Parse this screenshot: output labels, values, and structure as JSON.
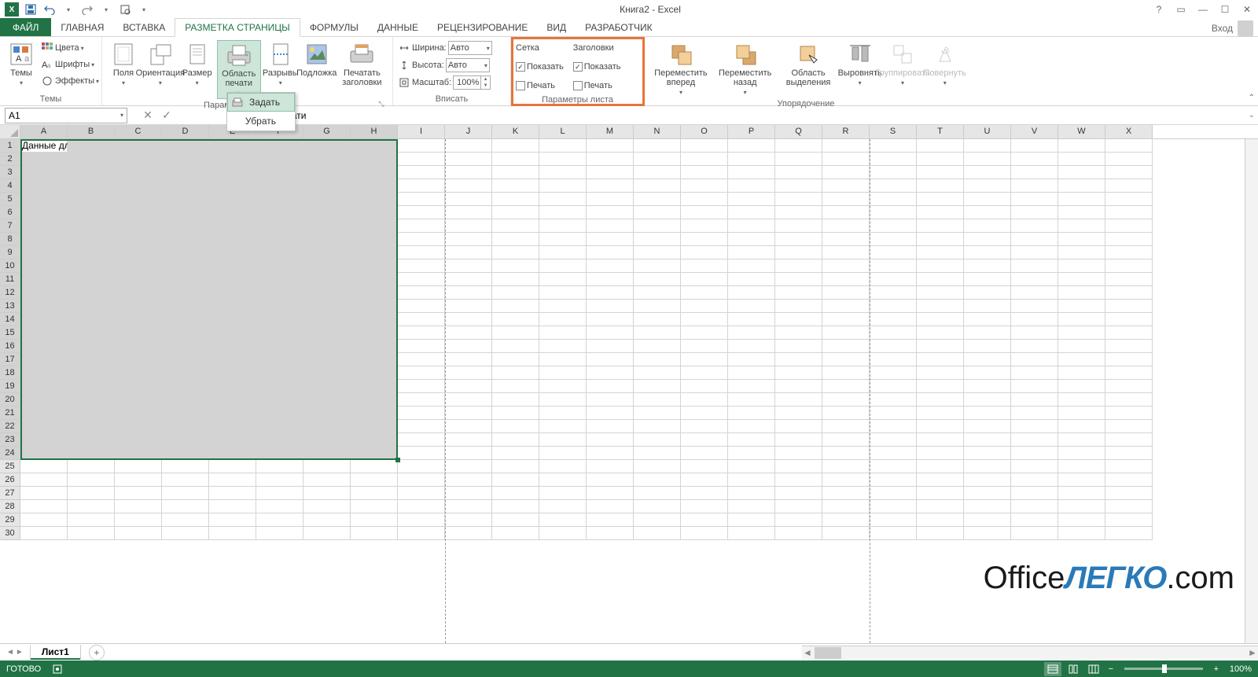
{
  "title": "Книга2 - Excel",
  "qat": {
    "save": "save",
    "undo": "undo",
    "redo": "redo",
    "preview": "preview"
  },
  "tabs": {
    "file": "ФАЙЛ",
    "items": [
      "ГЛАВНАЯ",
      "ВСТАВКА",
      "РАЗМЕТКА СТРАНИЦЫ",
      "ФОРМУЛЫ",
      "ДАННЫЕ",
      "РЕЦЕНЗИРОВАНИЕ",
      "ВИД",
      "РАЗРАБОТЧИК"
    ],
    "active_index": 2,
    "login": "Вход"
  },
  "ribbon": {
    "themes": {
      "label": "Темы",
      "btn": "Темы",
      "colors": "Цвета",
      "fonts": "Шрифты",
      "effects": "Эффекты"
    },
    "page_setup": {
      "label": "Параметры страницы",
      "margins": "Поля",
      "orientation": "Ориентация",
      "size": "Размер",
      "print_area": "Область печати",
      "breaks": "Разрывы",
      "background": "Подложка",
      "print_titles": "Печатать заголовки"
    },
    "dropdown": {
      "set": "Задать",
      "clear": "Убрать"
    },
    "fit": {
      "label": "Вписать",
      "width_label": "Ширина:",
      "width_value": "Авто",
      "height_label": "Высота:",
      "height_value": "Авто",
      "scale_label": "Масштаб:",
      "scale_value": "100%"
    },
    "sheet_options": {
      "label": "Параметры листа",
      "grid_title": "Сетка",
      "headings_title": "Заголовки",
      "show": "Показать",
      "print": "Печать",
      "grid_show": true,
      "grid_print": false,
      "head_show": true,
      "head_print": false
    },
    "arrange": {
      "label": "Упорядочение",
      "forward": "Переместить вперед",
      "backward": "Переместить назад",
      "selection": "Область выделения",
      "align": "Выровнять",
      "group": "Группировать",
      "rotate": "Повернуть"
    }
  },
  "name_box": "A1",
  "formula_text": "для печати",
  "cell_a1": "Данные для печати",
  "columns": [
    "A",
    "B",
    "C",
    "D",
    "E",
    "F",
    "G",
    "H",
    "I",
    "J",
    "K",
    "L",
    "M",
    "N",
    "O",
    "P",
    "Q",
    "R",
    "S",
    "T",
    "U",
    "V",
    "W",
    "X"
  ],
  "rows_count": 30,
  "sheet": {
    "name": "Лист1"
  },
  "status": {
    "ready": "ГОТОВО",
    "zoom": "100%"
  },
  "watermark": {
    "pre": "Office",
    "mid": "ЛЕГКО",
    "post": ".com"
  }
}
